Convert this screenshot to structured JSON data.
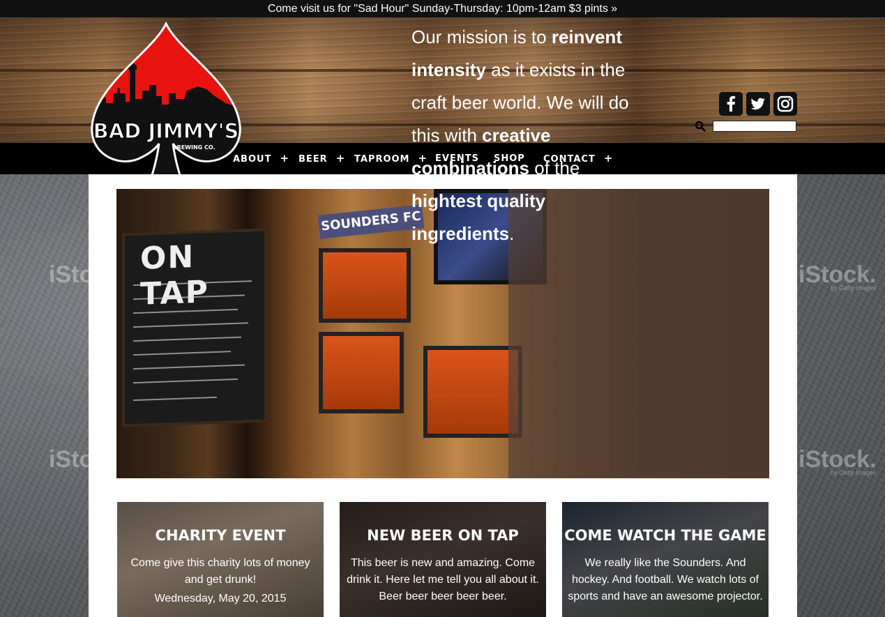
{
  "banner": {
    "text": "Come visit us for \"Sad Hour\" Sunday-Thursday: 10pm-12am $3 pints »"
  },
  "logo": {
    "name": "BAD JIMMY'S",
    "sub": "BREWING CO."
  },
  "social": {
    "facebook": "f",
    "twitter": "t",
    "instagram": "ig"
  },
  "search": {
    "placeholder": ""
  },
  "nav": [
    {
      "label": "ABOUT",
      "has_sub": "+"
    },
    {
      "label": "BEER",
      "has_sub": "+"
    },
    {
      "label": "TAPROOM",
      "has_sub": "+"
    },
    {
      "label": "EVENTS"
    },
    {
      "label": "SHOP"
    },
    {
      "label": "CONTACT",
      "has_sub": "+"
    }
  ],
  "hero": {
    "chalkboard_title": "ON TAP",
    "scarf": "SOUNDERS FC",
    "mission": {
      "p1": "Our mission is to ",
      "b1": "reinvent intensity",
      "p2": " as it exists in the craft beer world. We will do this with ",
      "b2": "creative combinations",
      "p3": " of the ",
      "b3": "hightest quality ingredients",
      "p4": "."
    }
  },
  "cards": [
    {
      "title": "CHARITY EVENT",
      "text": "Come give this charity lots of money and get drunk!",
      "date": "Wednesday, May 20, 2015"
    },
    {
      "title": "NEW BEER ON TAP",
      "text": "This beer is new and amazing. Come drink it. Here let me tell you all about it. Beer beer beer beer beer.",
      "date": ""
    },
    {
      "title": "COME WATCH THE GAME",
      "text": "We really like the Sounders. And hockey. And football. We watch lots of sports and have an awesome projector.",
      "date": ""
    }
  ],
  "watermark": {
    "brand": "iStock.",
    "sub": "by Getty Images"
  }
}
